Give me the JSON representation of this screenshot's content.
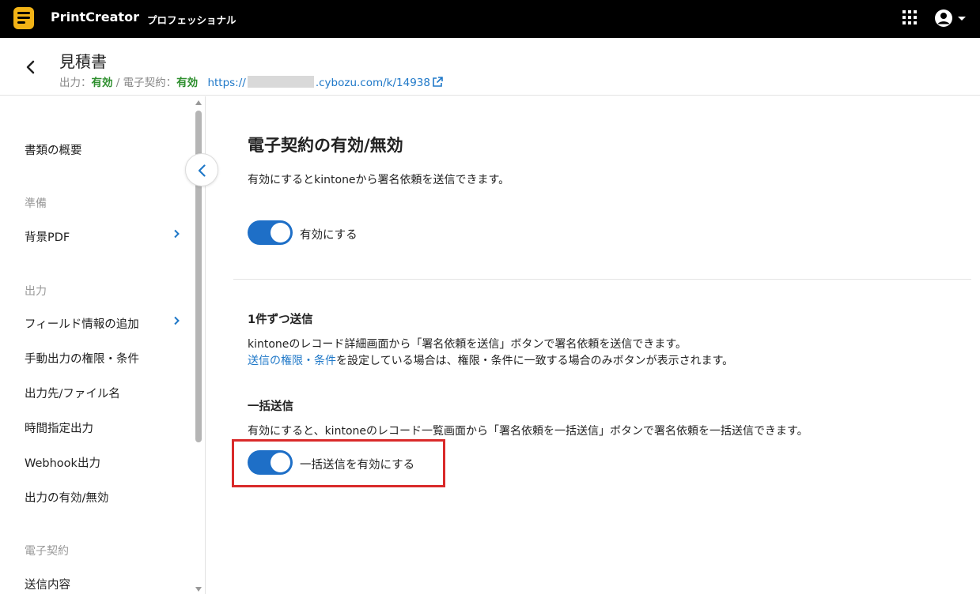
{
  "topbar": {
    "brand": "PrintCreator",
    "edition": "プロフェッショナル",
    "logo_icon": "printcreator-logo-icon",
    "apps_icon": "apps-grid-icon",
    "account_icon": "account-circle-icon"
  },
  "header": {
    "title": "見積書",
    "output_label": "出力：",
    "output_value": "有効",
    "separator": " / ",
    "esign_label": "電子契約：",
    "esign_value": "有効",
    "url_prefix": "https://",
    "url_suffix": ".cybozu.com/k/14938"
  },
  "sidebar": {
    "overview": "書類の概要",
    "section_prep": "準備",
    "bg_pdf": "背景PDF",
    "section_output": "出力",
    "field_info": "フィールド情報の追加",
    "manual_output": "手動出力の権限・条件",
    "destination": "出力先/ファイル名",
    "scheduled": "時間指定出力",
    "webhook": "Webhook出力",
    "output_toggle": "出力の有効/無効",
    "section_esign": "電子契約",
    "send_content": "送信内容"
  },
  "main": {
    "title": "電子契約の有効/無効",
    "description": "有効にするとkintoneから署名依頼を送信できます。",
    "enable_label": "有効にする",
    "enable_on": true,
    "single_heading": "1件ずつ送信",
    "single_desc": "kintoneのレコード詳細画面から「署名依頼を送信」ボタンで署名依頼を送信できます。",
    "single_link": "送信の権限・条件",
    "single_note": "を設定している場合は、権限・条件に一致する場合のみボタンが表示されます。",
    "bulk_heading": "一括送信",
    "bulk_desc": "有効にすると、kintoneのレコード一覧画面から「署名依頼を一括送信」ボタンで署名依頼を一括送信できます。",
    "bulk_label": "一括送信を有効にする",
    "bulk_on": true
  },
  "colors": {
    "accent": "#1e6fc7",
    "status_ok": "#2e8f2e",
    "highlight": "#d92a2a"
  }
}
